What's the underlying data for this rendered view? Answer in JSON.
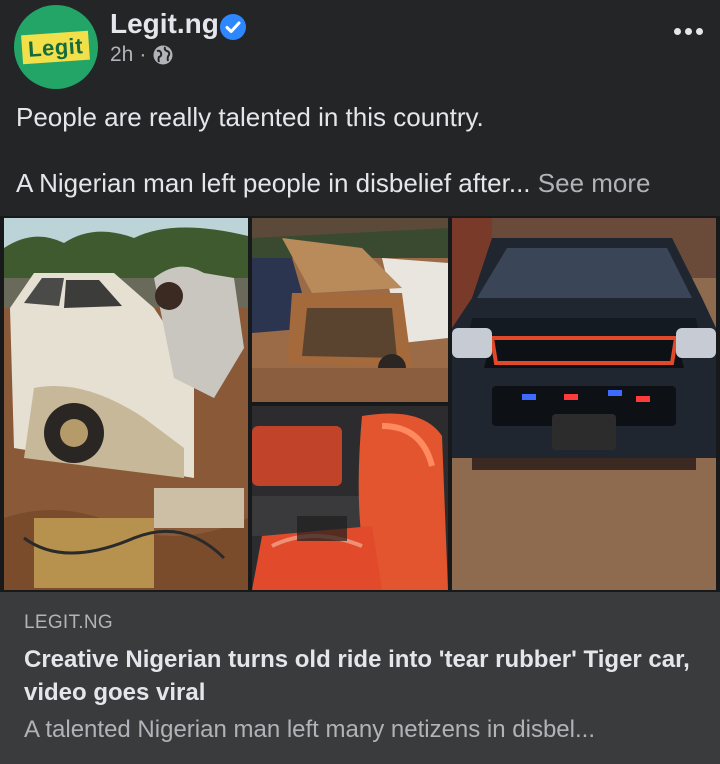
{
  "post": {
    "page_name": "Legit.ng",
    "avatar_text": "Legit",
    "time": "2h",
    "separator": "·",
    "text_line1": "People are really talented in this country.",
    "text_line2": "A Nigerian man left people in disbelief after...",
    "see_more": "See more"
  },
  "photos": [
    {
      "name": "old-white-pickup-photo"
    },
    {
      "name": "stripped-car-shell-photo"
    },
    {
      "name": "red-car-seats-photo"
    },
    {
      "name": "black-tiger-car-photo"
    }
  ],
  "link_preview": {
    "domain": "LEGIT.NG",
    "title": "Creative Nigerian turns old ride into 'tear rubber' Tiger car, video goes viral",
    "description": "A talented Nigerian man left many netizens in disbel..."
  },
  "colors": {
    "background": "#242526",
    "card": "#3a3b3c",
    "verified": "#2d88ff",
    "avatar_bg": "#22a567",
    "avatar_badge": "#f2e04a"
  },
  "icons": [
    "verified-badge-icon",
    "globe-icon",
    "more-options-icon"
  ]
}
